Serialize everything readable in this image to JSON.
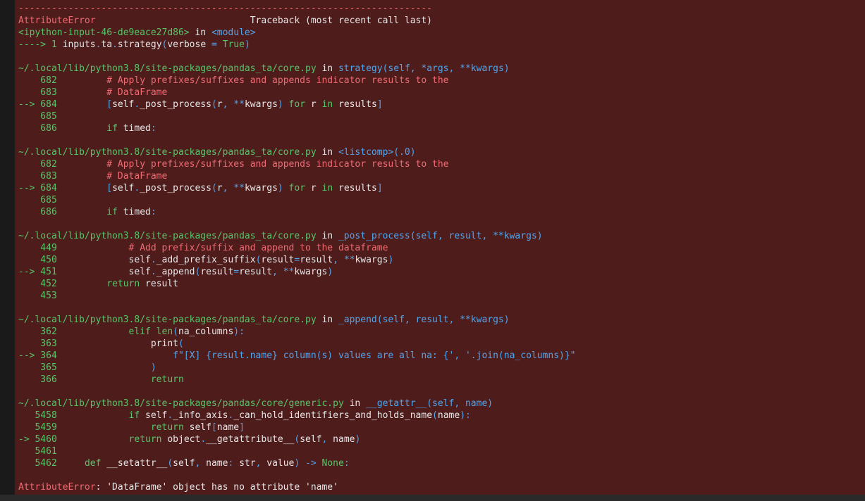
{
  "theme": {
    "background": "#4f1c1c",
    "red": "#ef6b73",
    "green": "#57c46a",
    "blue": "#4fa6ef",
    "text": "#e6e6e6"
  },
  "lines": [
    [
      {
        "t": "---------------------------------------------------------------------------",
        "c": "red"
      }
    ],
    [
      {
        "t": "AttributeError",
        "c": "red"
      },
      {
        "t": "                            Traceback (most recent call last)",
        "c": "white"
      }
    ],
    [
      {
        "t": "<ipython-input-46-de9eace27d86>",
        "c": "green"
      },
      {
        "t": " in ",
        "c": "white"
      },
      {
        "t": "<module>",
        "c": "blue"
      }
    ],
    [
      {
        "t": "----> 1 ",
        "c": "green"
      },
      {
        "t": "inputs",
        "c": "white"
      },
      {
        "t": ".",
        "c": "blue"
      },
      {
        "t": "ta",
        "c": "white"
      },
      {
        "t": ".",
        "c": "blue"
      },
      {
        "t": "strategy",
        "c": "white"
      },
      {
        "t": "(",
        "c": "blue"
      },
      {
        "t": "verbose ",
        "c": "white"
      },
      {
        "t": "=",
        "c": "blue"
      },
      {
        "t": " True",
        "c": "green"
      },
      {
        "t": ")",
        "c": "blue"
      }
    ],
    [],
    [
      {
        "t": "~/.local/lib/python3.8/site-packages/pandas_ta/core.py",
        "c": "green"
      },
      {
        "t": " in ",
        "c": "white"
      },
      {
        "t": "strategy",
        "c": "blue"
      },
      {
        "t": "(self, *args, **kwargs)",
        "c": "blue"
      }
    ],
    [
      {
        "t": "    682",
        "c": "green"
      },
      {
        "t": "         # Apply prefixes/suffixes and appends indicator results to the",
        "c": "red"
      }
    ],
    [
      {
        "t": "    683",
        "c": "green"
      },
      {
        "t": "         # DataFrame",
        "c": "red"
      }
    ],
    [
      {
        "t": "--> 684",
        "c": "green"
      },
      {
        "t": "         ",
        "c": "white"
      },
      {
        "t": "[",
        "c": "blue"
      },
      {
        "t": "self",
        "c": "white"
      },
      {
        "t": ".",
        "c": "blue"
      },
      {
        "t": "_post_process",
        "c": "white"
      },
      {
        "t": "(",
        "c": "blue"
      },
      {
        "t": "r",
        "c": "white"
      },
      {
        "t": ", ",
        "c": "blue"
      },
      {
        "t": "**",
        "c": "blue"
      },
      {
        "t": "kwargs",
        "c": "white"
      },
      {
        "t": ")",
        "c": "blue"
      },
      {
        "t": " for",
        "c": "green"
      },
      {
        "t": " r ",
        "c": "white"
      },
      {
        "t": "in",
        "c": "green"
      },
      {
        "t": " results",
        "c": "white"
      },
      {
        "t": "]",
        "c": "blue"
      }
    ],
    [
      {
        "t": "    685",
        "c": "green"
      }
    ],
    [
      {
        "t": "    686",
        "c": "green"
      },
      {
        "t": "         ",
        "c": "white"
      },
      {
        "t": "if",
        "c": "green"
      },
      {
        "t": " timed",
        "c": "white"
      },
      {
        "t": ":",
        "c": "blue"
      }
    ],
    [],
    [
      {
        "t": "~/.local/lib/python3.8/site-packages/pandas_ta/core.py",
        "c": "green"
      },
      {
        "t": " in ",
        "c": "white"
      },
      {
        "t": "<listcomp>(.0)",
        "c": "blue"
      }
    ],
    [
      {
        "t": "    682",
        "c": "green"
      },
      {
        "t": "         # Apply prefixes/suffixes and appends indicator results to the",
        "c": "red"
      }
    ],
    [
      {
        "t": "    683",
        "c": "green"
      },
      {
        "t": "         # DataFrame",
        "c": "red"
      }
    ],
    [
      {
        "t": "--> 684",
        "c": "green"
      },
      {
        "t": "         ",
        "c": "white"
      },
      {
        "t": "[",
        "c": "blue"
      },
      {
        "t": "self",
        "c": "white"
      },
      {
        "t": ".",
        "c": "blue"
      },
      {
        "t": "_post_process",
        "c": "white"
      },
      {
        "t": "(",
        "c": "blue"
      },
      {
        "t": "r",
        "c": "white"
      },
      {
        "t": ", ",
        "c": "blue"
      },
      {
        "t": "**",
        "c": "blue"
      },
      {
        "t": "kwargs",
        "c": "white"
      },
      {
        "t": ")",
        "c": "blue"
      },
      {
        "t": " for",
        "c": "green"
      },
      {
        "t": " r ",
        "c": "white"
      },
      {
        "t": "in",
        "c": "green"
      },
      {
        "t": " results",
        "c": "white"
      },
      {
        "t": "]",
        "c": "blue"
      }
    ],
    [
      {
        "t": "    685",
        "c": "green"
      }
    ],
    [
      {
        "t": "    686",
        "c": "green"
      },
      {
        "t": "         ",
        "c": "white"
      },
      {
        "t": "if",
        "c": "green"
      },
      {
        "t": " timed",
        "c": "white"
      },
      {
        "t": ":",
        "c": "blue"
      }
    ],
    [],
    [
      {
        "t": "~/.local/lib/python3.8/site-packages/pandas_ta/core.py",
        "c": "green"
      },
      {
        "t": " in ",
        "c": "white"
      },
      {
        "t": "_post_process",
        "c": "blue"
      },
      {
        "t": "(self, result, **kwargs)",
        "c": "blue"
      }
    ],
    [
      {
        "t": "    449",
        "c": "green"
      },
      {
        "t": "             # Add prefix/suffix and append to the dataframe",
        "c": "red"
      }
    ],
    [
      {
        "t": "    450",
        "c": "green"
      },
      {
        "t": "             self",
        "c": "white"
      },
      {
        "t": ".",
        "c": "blue"
      },
      {
        "t": "_add_prefix_suffix",
        "c": "white"
      },
      {
        "t": "(",
        "c": "blue"
      },
      {
        "t": "result",
        "c": "white"
      },
      {
        "t": "=",
        "c": "blue"
      },
      {
        "t": "result",
        "c": "white"
      },
      {
        "t": ", **",
        "c": "blue"
      },
      {
        "t": "kwargs",
        "c": "white"
      },
      {
        "t": ")",
        "c": "blue"
      }
    ],
    [
      {
        "t": "--> 451",
        "c": "green"
      },
      {
        "t": "             self",
        "c": "white"
      },
      {
        "t": ".",
        "c": "blue"
      },
      {
        "t": "_append",
        "c": "white"
      },
      {
        "t": "(",
        "c": "blue"
      },
      {
        "t": "result",
        "c": "white"
      },
      {
        "t": "=",
        "c": "blue"
      },
      {
        "t": "result",
        "c": "white"
      },
      {
        "t": ", **",
        "c": "blue"
      },
      {
        "t": "kwargs",
        "c": "white"
      },
      {
        "t": ")",
        "c": "blue"
      }
    ],
    [
      {
        "t": "    452",
        "c": "green"
      },
      {
        "t": "         ",
        "c": "white"
      },
      {
        "t": "return",
        "c": "green"
      },
      {
        "t": " result",
        "c": "white"
      }
    ],
    [
      {
        "t": "    453",
        "c": "green"
      }
    ],
    [],
    [
      {
        "t": "~/.local/lib/python3.8/site-packages/pandas_ta/core.py",
        "c": "green"
      },
      {
        "t": " in ",
        "c": "white"
      },
      {
        "t": "_append",
        "c": "blue"
      },
      {
        "t": "(self, result, **kwargs)",
        "c": "blue"
      }
    ],
    [
      {
        "t": "    362",
        "c": "green"
      },
      {
        "t": "             ",
        "c": "white"
      },
      {
        "t": "elif",
        "c": "green"
      },
      {
        "t": " len",
        "c": "green"
      },
      {
        "t": "(",
        "c": "blue"
      },
      {
        "t": "na_columns",
        "c": "white"
      },
      {
        "t": "):",
        "c": "blue"
      }
    ],
    [
      {
        "t": "    363",
        "c": "green"
      },
      {
        "t": "                 ",
        "c": "white"
      },
      {
        "t": "print",
        "c": "white"
      },
      {
        "t": "(",
        "c": "blue"
      }
    ],
    [
      {
        "t": "--> 364",
        "c": "green"
      },
      {
        "t": "                     f\"[X] {result.name} column(s) values are all na: {', '.join(na_columns)}\"",
        "c": "blue"
      }
    ],
    [
      {
        "t": "    365",
        "c": "green"
      },
      {
        "t": "                 )",
        "c": "blue"
      }
    ],
    [
      {
        "t": "    366",
        "c": "green"
      },
      {
        "t": "                 ",
        "c": "white"
      },
      {
        "t": "return",
        "c": "green"
      }
    ],
    [],
    [
      {
        "t": "~/.local/lib/python3.8/site-packages/pandas/core/generic.py",
        "c": "green"
      },
      {
        "t": " in ",
        "c": "white"
      },
      {
        "t": "__getattr__",
        "c": "blue"
      },
      {
        "t": "(self, name)",
        "c": "blue"
      }
    ],
    [
      {
        "t": "   5458",
        "c": "green"
      },
      {
        "t": "             ",
        "c": "white"
      },
      {
        "t": "if",
        "c": "green"
      },
      {
        "t": " self",
        "c": "white"
      },
      {
        "t": ".",
        "c": "blue"
      },
      {
        "t": "_info_axis",
        "c": "white"
      },
      {
        "t": ".",
        "c": "blue"
      },
      {
        "t": "_can_hold_identifiers_and_holds_name",
        "c": "white"
      },
      {
        "t": "(",
        "c": "blue"
      },
      {
        "t": "name",
        "c": "white"
      },
      {
        "t": "):",
        "c": "blue"
      }
    ],
    [
      {
        "t": "   5459",
        "c": "green"
      },
      {
        "t": "                 ",
        "c": "white"
      },
      {
        "t": "return",
        "c": "green"
      },
      {
        "t": " self",
        "c": "white"
      },
      {
        "t": "[",
        "c": "blue"
      },
      {
        "t": "name",
        "c": "white"
      },
      {
        "t": "]",
        "c": "blue"
      }
    ],
    [
      {
        "t": "-> 5460",
        "c": "green"
      },
      {
        "t": "             ",
        "c": "white"
      },
      {
        "t": "return",
        "c": "green"
      },
      {
        "t": " object",
        "c": "white"
      },
      {
        "t": ".",
        "c": "blue"
      },
      {
        "t": "__getattribute__",
        "c": "white"
      },
      {
        "t": "(",
        "c": "blue"
      },
      {
        "t": "self",
        "c": "white"
      },
      {
        "t": ", ",
        "c": "blue"
      },
      {
        "t": "name",
        "c": "white"
      },
      {
        "t": ")",
        "c": "blue"
      }
    ],
    [
      {
        "t": "   5461",
        "c": "green"
      }
    ],
    [
      {
        "t": "   5462",
        "c": "green"
      },
      {
        "t": "     ",
        "c": "white"
      },
      {
        "t": "def",
        "c": "green"
      },
      {
        "t": " __setattr__",
        "c": "white"
      },
      {
        "t": "(",
        "c": "blue"
      },
      {
        "t": "self",
        "c": "white"
      },
      {
        "t": ", ",
        "c": "blue"
      },
      {
        "t": "name",
        "c": "white"
      },
      {
        "t": ": ",
        "c": "blue"
      },
      {
        "t": "str",
        "c": "white"
      },
      {
        "t": ", ",
        "c": "blue"
      },
      {
        "t": "value",
        "c": "white"
      },
      {
        "t": ")",
        "c": "blue"
      },
      {
        "t": " -> ",
        "c": "blue"
      },
      {
        "t": "None",
        "c": "green"
      },
      {
        "t": ":",
        "c": "blue"
      }
    ],
    [],
    [
      {
        "t": "AttributeError",
        "c": "red"
      },
      {
        "t": ": 'DataFrame' object has no attribute 'name'",
        "c": "white"
      }
    ]
  ]
}
